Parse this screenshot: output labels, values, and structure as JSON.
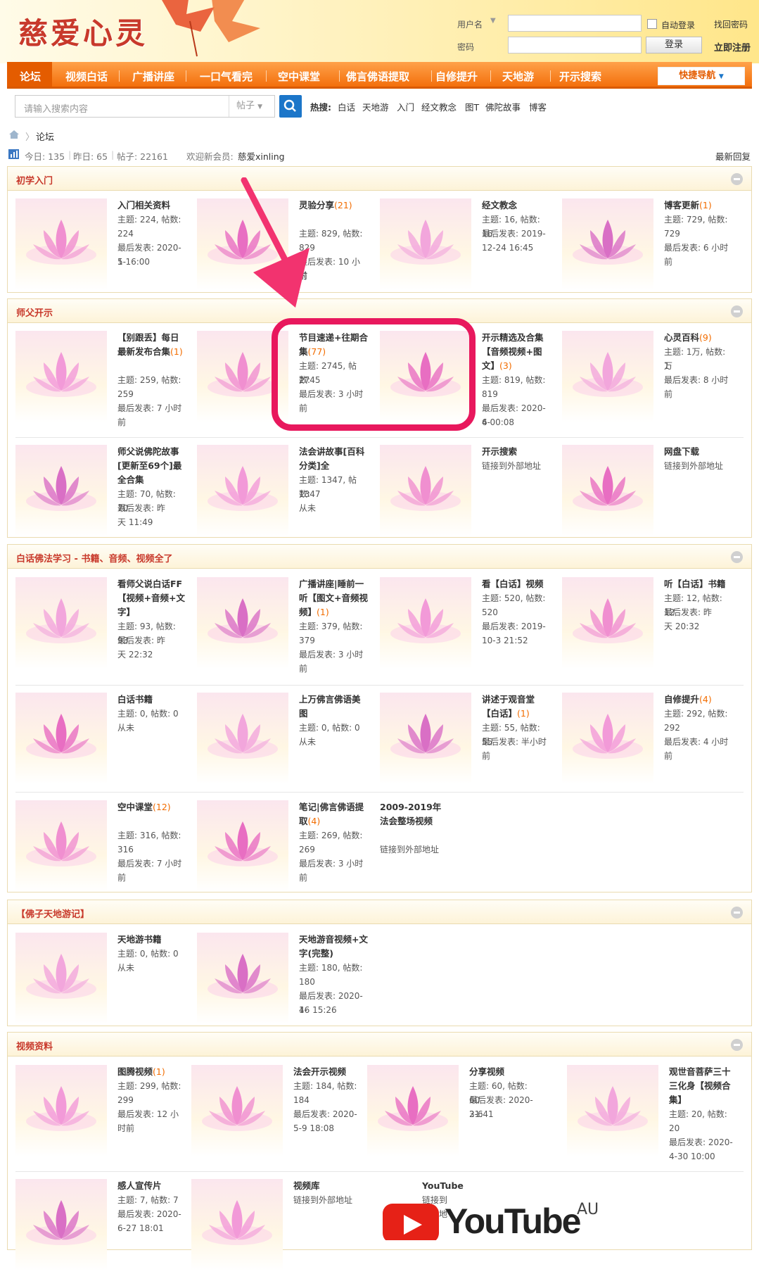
{
  "header": {
    "logo": "慈爱心灵",
    "username_label": "用户名",
    "password_label": "密码",
    "auto_login": "自动登录",
    "find_password": "找回密码",
    "login_button": "登录",
    "register": "立即注册"
  },
  "nav": {
    "items": [
      "论坛",
      "视频白话",
      "广播讲座",
      "一口气看完",
      "空中课堂",
      "佛言佛语提取",
      "自修提升",
      "天地游",
      "开示搜索"
    ],
    "quick_nav": "快捷导航"
  },
  "search": {
    "placeholder": "请输入搜索内容",
    "type": "帖子",
    "hot_label": "热搜:",
    "hot": [
      "白话",
      "天地游",
      "入门",
      "经文教念",
      "图T",
      "佛陀故事",
      "博客"
    ]
  },
  "breadcrumb": {
    "current": "论坛"
  },
  "stats": {
    "today": "今日: 135",
    "yesterday": "昨日: 65",
    "posts": "帖子: 22161",
    "welcome": "欢迎新会员:",
    "member": "慈爱xinling",
    "latest": "最新回复"
  },
  "sections": [
    {
      "title": "初学入门",
      "forums": [
        {
          "name": "入门相关资料",
          "count": "",
          "lines": [
            "主题: 224, 帖数:",
            "224",
            "最后发表: 2020-5-",
            "1 16:00"
          ]
        },
        {
          "name": "灵验分享",
          "count": "(21)",
          "lines": [
            "主题: 829, 帖数:",
            "829",
            "最后发表: 10 小时",
            "前"
          ]
        },
        {
          "name": "经文教念",
          "count": "",
          "lines": [
            "主题: 16, 帖数: 16",
            "最后发表: 2019-",
            "12-24 16:45"
          ]
        },
        {
          "name": "博客更新",
          "count": "(1)",
          "lines": [
            "主题: 729, 帖数:",
            "729",
            "最后发表: 6 小时",
            "前"
          ]
        }
      ]
    },
    {
      "title": "师父开示",
      "forums": [
        {
          "name": "【别跟丢】每日最新发布合集",
          "count": "(1)",
          "lines": [
            "主题: 259, 帖数:",
            "259",
            "最后发表: 7 小时",
            "前"
          ]
        },
        {
          "name": "节目速递+往期合集",
          "count": "(77)",
          "lines": [
            "主题: 2745, 帖数:",
            "2745",
            "最后发表: 3 小时",
            "前"
          ]
        },
        {
          "name": "开示精选及合集【音频视频+图文】",
          "count": "(3)",
          "lines": [
            "主题: 819, 帖数:",
            "819",
            "最后发表: 2020-4-",
            "6 00:08"
          ]
        },
        {
          "name": "心灵百科",
          "count": "(9)",
          "lines": [
            "主题: 1万, 帖数: 1",
            "万",
            "最后发表: 8 小时",
            "前"
          ]
        },
        {
          "name": "师父说佛陀故事[更新至69个]最全合集",
          "count": "",
          "lines": [
            "主题: 70, 帖数: 70",
            "最后发表: 昨",
            "天 11:49"
          ]
        },
        {
          "name": "法会讲故事[百科分类]全",
          "count": "",
          "lines": [
            "主题: 1347, 帖数:",
            "1347",
            "从未"
          ]
        },
        {
          "name": "开示搜索",
          "count": "",
          "lines": [
            "链接到外部地址"
          ]
        },
        {
          "name": "网盘下载",
          "count": "",
          "lines": [
            "链接到外部地址"
          ]
        }
      ]
    },
    {
      "title": "白话佛法学习 - 书籍、音频、视频全了",
      "forums": [
        {
          "name": "看师父说白话FF【视频+音频+文字】",
          "count": "",
          "lines": [
            "主题: 93, 帖数: 93",
            "最后发表: 昨",
            "天 22:32"
          ]
        },
        {
          "name": "广播讲座|睡前一听【图文+音频视频】",
          "count": "(1)",
          "lines": [
            "主题: 379, 帖数:",
            "379",
            "最后发表: 3 小时",
            "前"
          ]
        },
        {
          "name": "看【白话】视频",
          "count": "",
          "lines": [
            "主题: 520, 帖数:",
            "520",
            "最后发表: 2019-",
            "10-3 21:52"
          ]
        },
        {
          "name": "听【白话】书籍",
          "count": "",
          "lines": [
            "主题: 12, 帖数: 12",
            "最后发表: 昨",
            "天 20:32"
          ]
        },
        {
          "name": "白话书籍",
          "count": "",
          "lines": [
            "主题: 0, 帖数: 0",
            "从未"
          ]
        },
        {
          "name": "上万佛言佛语美图",
          "count": "",
          "lines": [
            "主题: 0, 帖数: 0",
            "从未"
          ]
        },
        {
          "name": "讲述于观音堂【白话】",
          "count": "(1)",
          "lines": [
            "主题: 55, 帖数: 55",
            "最后发表: 半小时",
            "前"
          ]
        },
        {
          "name": "自修提升",
          "count": "(4)",
          "lines": [
            "主题: 292, 帖数:",
            "292",
            "最后发表: 4 小时",
            "前"
          ]
        },
        {
          "name": "空中课堂",
          "count": "(12)",
          "lines": [
            "主题: 316, 帖数:",
            "316",
            "最后发表: 7 小时",
            "前"
          ]
        },
        {
          "name": "笔记|佛言佛语提取",
          "count": "(4)",
          "lines": [
            "主题: 269, 帖数:",
            "269",
            "最后发表: 3 小时",
            "前"
          ]
        },
        {
          "name": "2009-2019年法会整场视频",
          "count": "",
          "lines": [
            "链接到外部地址"
          ]
        }
      ]
    },
    {
      "title": "【佛子天地游记】",
      "forums": [
        {
          "name": "天地游书籍",
          "count": "",
          "lines": [
            "主题: 0, 帖数: 0",
            "从未"
          ]
        },
        {
          "name": "天地游音视频+文字(完整)",
          "count": "",
          "lines": [
            "主题: 180, 帖数:",
            "180",
            "最后发表: 2020-4-",
            "16 15:26"
          ]
        }
      ]
    },
    {
      "title": "视频资料",
      "forums": [
        {
          "name": "图腾视频",
          "count": "(1)",
          "lines": [
            "主题: 299, 帖数:",
            "299",
            "最后发表: 12 小",
            "时前"
          ]
        },
        {
          "name": "法会开示视频",
          "count": "",
          "lines": [
            "主题: 184, 帖数:",
            "184",
            "最后发表: 2020-",
            "5-9 18:08"
          ]
        },
        {
          "name": "分享视频",
          "count": "",
          "lines": [
            "主题: 60, 帖数: 60",
            "最后发表: 2020-3-6",
            "21:41"
          ]
        },
        {
          "name": "观世音菩萨三十三化身【视频合集】",
          "count": "",
          "lines": [
            "主题: 20, 帖数:",
            "20",
            "最后发表: 2020-",
            "4-30 10:00"
          ]
        },
        {
          "name": "感人宣传片",
          "count": "",
          "lines": [
            "主题: 7, 帖数: 7",
            "最后发表: 2020-",
            "6-27 18:01"
          ]
        },
        {
          "name": "视频库",
          "count": "",
          "lines": [
            "链接到外部地址"
          ]
        },
        {
          "name": "YouTube",
          "count": "",
          "lines": [
            "链接到",
            "外部地",
            "址"
          ]
        }
      ]
    }
  ],
  "youtube_overlay": {
    "brand": "YouTube",
    "region": "AU"
  },
  "colors": {
    "nav": "#f36f0c",
    "accent": "#c8392b",
    "count": "#f26c00",
    "highlight": "#e8185d",
    "arrow": "#f2336f"
  }
}
